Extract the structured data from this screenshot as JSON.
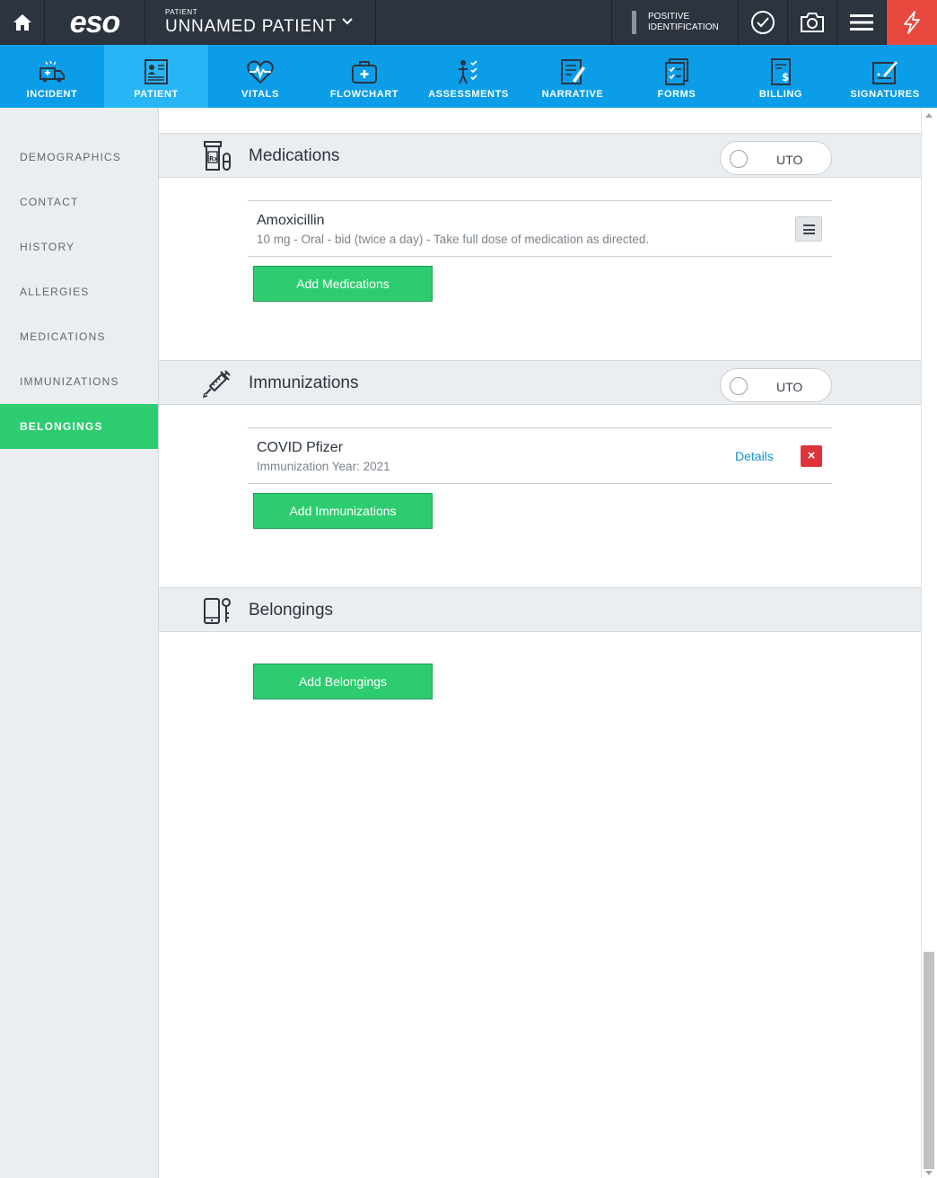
{
  "topbar": {
    "logo": "eso",
    "patient_label": "PATIENT",
    "patient_name": "UNNAMED PATIENT",
    "positive_id_line1": "POSITIVE",
    "positive_id_line2": "IDENTIFICATION",
    "icons": [
      "home-icon",
      "chevron-down-icon",
      "check-circle-icon",
      "camera-icon",
      "hamburger-menu-icon",
      "lightning-icon"
    ]
  },
  "nav": {
    "items": [
      {
        "label": "INCIDENT",
        "icon": "ambulance-icon"
      },
      {
        "label": "PATIENT",
        "icon": "patient-chart-icon"
      },
      {
        "label": "VITALS",
        "icon": "heartbeat-icon"
      },
      {
        "label": "FLOWCHART",
        "icon": "medkit-icon"
      },
      {
        "label": "ASSESSMENTS",
        "icon": "assessment-icon"
      },
      {
        "label": "NARRATIVE",
        "icon": "narrative-icon"
      },
      {
        "label": "FORMS",
        "icon": "forms-icon"
      },
      {
        "label": "BILLING",
        "icon": "billing-icon"
      },
      {
        "label": "SIGNATURES",
        "icon": "signature-icon"
      }
    ],
    "active": "PATIENT"
  },
  "sidebar": {
    "items": [
      {
        "label": "DEMOGRAPHICS"
      },
      {
        "label": "CONTACT"
      },
      {
        "label": "HISTORY"
      },
      {
        "label": "ALLERGIES"
      },
      {
        "label": "MEDICATIONS"
      },
      {
        "label": "IMMUNIZATIONS"
      },
      {
        "label": "BELONGINGS"
      }
    ],
    "active": "BELONGINGS"
  },
  "medications": {
    "title": "Medications",
    "uto_label": "UTO",
    "items": [
      {
        "name": "Amoxicillin",
        "detail": "10 mg - Oral - bid (twice a day) - Take full dose of medication as directed."
      }
    ],
    "add_label": "Add Medications"
  },
  "immunizations": {
    "title": "Immunizations",
    "uto_label": "UTO",
    "items": [
      {
        "name": "COVID Pfizer",
        "detail": "Immunization Year: 2021",
        "details_link": "Details",
        "delete_glyph": "×"
      }
    ],
    "add_label": "Add Immunizations"
  },
  "belongings": {
    "title": "Belongings",
    "add_label": "Add Belongings"
  },
  "colors": {
    "topbar": "#2c3440",
    "nav": "#0b9de8",
    "nav_active": "#27b5f5",
    "green": "#2ecc71",
    "danger": "#e0323a",
    "flash": "#e8483e",
    "link": "#1593d6"
  }
}
